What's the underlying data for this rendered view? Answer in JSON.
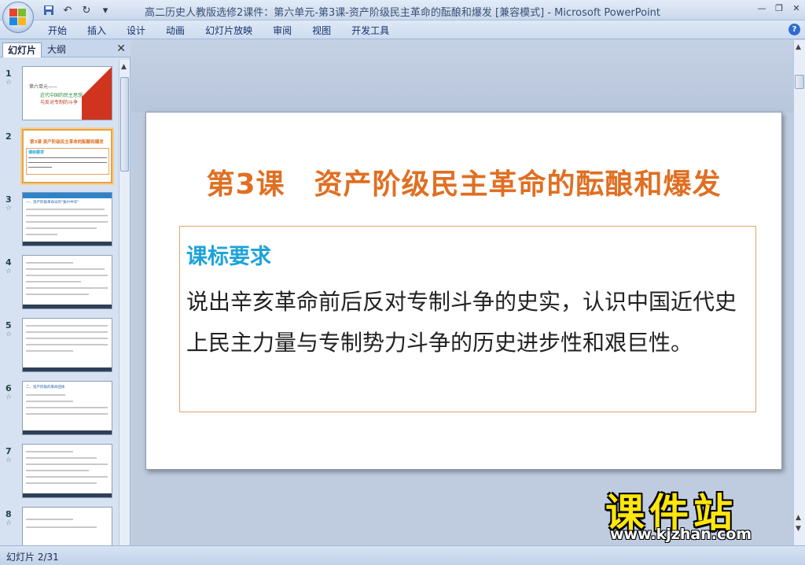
{
  "window": {
    "title": "高二历史人教版选修2课件：第六单元-第3课-资产阶级民主革命的酝酿和爆发 [兼容模式] - Microsoft PowerPoint",
    "controls": [
      "minimize",
      "restore",
      "close"
    ]
  },
  "quick_access": {
    "icons": [
      "save-icon",
      "undo-icon",
      "redo-icon",
      "customize-icon"
    ]
  },
  "ribbon": {
    "tabs": [
      "开始",
      "插入",
      "设计",
      "动画",
      "幻灯片放映",
      "审阅",
      "视图",
      "开发工具"
    ],
    "help": "?"
  },
  "panel": {
    "tab_slides": "幻灯片",
    "tab_outline": "大纲",
    "close": "✕",
    "thumbnails": [
      {
        "num": "1",
        "text_lines": [
          "第六单元——",
          "近代中国的民主思想",
          "与反对专制的斗争"
        ]
      },
      {
        "num": "2",
        "text_lines": [
          "第3课 资产阶级民主革命的酝酿和爆发",
          "课标要求"
        ]
      },
      {
        "num": "3",
        "text_lines": [
          "一、资产阶级革命派的\"振兴中华\""
        ]
      },
      {
        "num": "4",
        "text_lines": []
      },
      {
        "num": "5",
        "text_lines": []
      },
      {
        "num": "6",
        "text_lines": [
          "二、资产阶级的革命团体"
        ]
      },
      {
        "num": "7",
        "text_lines": []
      },
      {
        "num": "8",
        "text_lines": []
      }
    ],
    "selected_index": 1
  },
  "slide": {
    "title": "第3课　资产阶级民主革命的酝酿和爆发",
    "requirement_heading": "课标要求",
    "requirement_body": "说出辛亥革命前后反对专制斗争的史实，认识中国近代史上民主力量与专制势力斗争的历史进步性和艰巨性。"
  },
  "status": {
    "slide_counter": "幻灯片 2/31"
  },
  "watermark": {
    "big": "课件站",
    "url": "www.kjzhan.com"
  },
  "colors": {
    "title_orange": "#e06f22",
    "heading_blue": "#1ea3d9",
    "watermark_yellow": "#ffe60c"
  }
}
